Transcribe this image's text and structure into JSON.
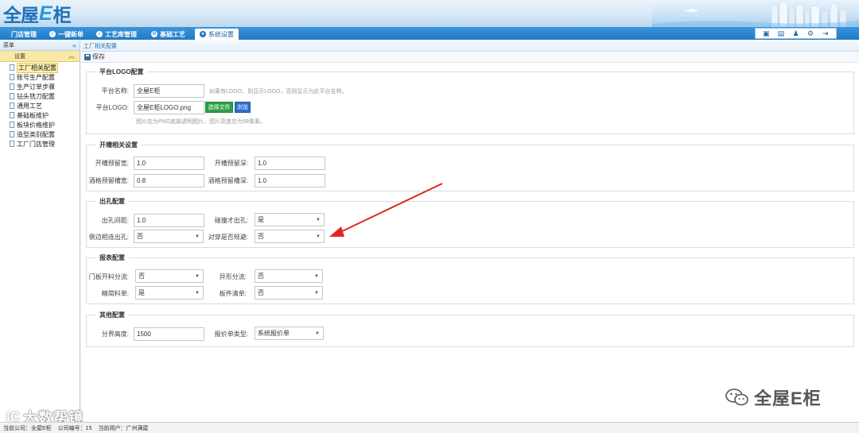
{
  "app": {
    "logo_part1": "全屋",
    "logo_part2": "E",
    "logo_part3": "柜"
  },
  "nav": {
    "tabs": [
      "门店管理",
      "一键新单",
      "工艺库管理",
      "基础工艺",
      "系统设置"
    ]
  },
  "sidebar": {
    "header": "菜单",
    "collapse_glyph": "«",
    "group": "设置",
    "group_glyph": "︽",
    "items": [
      "工厂相关配置",
      "账号生产配置",
      "生产订单步骤",
      "钻头铣刀配置",
      "通用工艺",
      "基础板维护",
      "板块价格维护",
      "造型类别配置",
      "工厂门店管理"
    ]
  },
  "main": {
    "breadcrumb": "工厂相关配置",
    "save_label": "保存",
    "logo_section": {
      "legend": "平台LOGO配置",
      "name_label": "平台名称:",
      "name_value": "全屋E柜",
      "name_hint": "如果有LOGO，则显示LOGO，否则显示为此平台名称。",
      "logo_label": "平台LOGO:",
      "logo_value": "全屋E柜LOGO.png",
      "choose_file": "选择文件",
      "browse": "浏览",
      "logo_hint": "图片应为PNG底部透明图片，图片高度应为58像素。"
    },
    "slot_section": {
      "legend": "开槽相关设置",
      "f1_label": "开槽预留宽:",
      "f1_value": "1.0",
      "f2_label": "开槽预留深:",
      "f2_value": "1.0",
      "f3_label": "酒格预留槽宽:",
      "f3_value": "0.8",
      "f4_label": "酒格预留槽深:",
      "f4_value": "1.0"
    },
    "hole_section": {
      "legend": "出孔配置",
      "f1_label": "出孔间距:",
      "f1_value": "1.0",
      "f2_label": "碰撞才出孔:",
      "f2_value": "是",
      "f3_label": "侧边相连出孔:",
      "f3_value": "否",
      "f4_label": "对穿是否规避:",
      "f4_value": "否"
    },
    "report_section": {
      "legend": "报表配置",
      "f1_label": "门板开料分流:",
      "f1_value": "否",
      "f2_label": "异形分流:",
      "f2_value": "否",
      "f3_label": "精简料单:",
      "f3_value": "是",
      "f4_label": "板件清单:",
      "f4_value": "否"
    },
    "other_section": {
      "legend": "其他配置",
      "f1_label": "分界高度:",
      "f1_value": "1500",
      "f2_label": "报价单类型:",
      "f2_value": "系统报价单"
    }
  },
  "status": {
    "company": "当前公司：全屋E柜",
    "company_no": "公司编号：15",
    "user": "当前用户：广州满屋"
  },
  "watermarks": {
    "right": "全屋E柜",
    "left_mark": "IC",
    "left_text": "大数帮镜"
  },
  "colors": {
    "navbar": "#2079c4",
    "accent_green": "#2e9e46",
    "accent_blue": "#2a6fcb",
    "annotation_arrow": "#e0261f",
    "selected_item": "#fcefab"
  }
}
